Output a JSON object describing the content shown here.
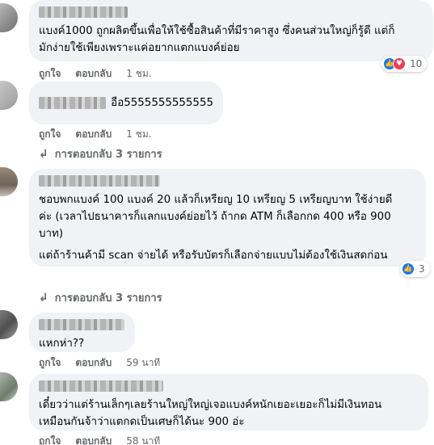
{
  "comments": [
    {
      "text": "แบงค์1000 ถูกผลิตขึ้นเพื่อให้ใช้ซื้อสินค้าที่มีราคาสูง ซึ่งคนส่วนใหญ่ก็รู้ดี แต่ก็\nมักง่ายใช้เพียงเพราะแค่อยากแตกแบงค์ย่อย",
      "like_label": "ถูกใจ",
      "reply_label": "ตอบกลับ",
      "time": "1 ชม.",
      "reaction_count": "10",
      "reaction_icons": [
        "like-icon",
        "love-icon"
      ]
    },
    {
      "text": "อือ5555555555555",
      "like_label": "ถูกใจ",
      "reply_label": "ตอบกลับ",
      "time": "1 ชม.",
      "replies_label": "การตอบกลับ 3 รายการ"
    },
    {
      "text": "ชอบพกแบงค์ 100 แบงค์ 20 แล้วก็เหรียญ 10 เหรียญ 5 เหรียญบาท ใช้ง่ายดี\nค่ะ (เวลาไปธนาคารก็แลกแบงค์ย่อยไว้ ถ้ากด ATM ก็เลือกกด 400 หรือ 900\nบาท)",
      "text2": "แต่ถ้าร้านค้ามี scan จ่ายได้ หรือรับบัตรก็เลือกจ่ายแบบไม่ต้องใช้เงินสดก่อน",
      "reaction_count": "3",
      "reaction_icons": [
        "like-icon"
      ],
      "replies_label": "การตอบกลับ 3 รายการ"
    },
    {
      "text": "แหกห่า??",
      "like_label": "ถูกใจ",
      "reply_label": "ตอบกลับ",
      "time": "59 นาที"
    },
    {
      "text": "เดี๋ยวว่าแต่ร้านเล็กๆเลยร้านใหญ่ใหญ่เจอแบงค์หนักเยอะเยอะก็ไม่มีเงินทอน\nเหมือนกันจ้าว่าแตกดเป็นเศษก็ได้นะ 900 อ่ะ",
      "like_label": "ถูกใจ",
      "reply_label": "ตอบกลับ",
      "time": "58 นาที"
    }
  ],
  "colors": {
    "bubble": "#f0f2f5",
    "meta_text": "#65676b",
    "like_blue": "#1877f2",
    "love_red": "#f33e58"
  }
}
